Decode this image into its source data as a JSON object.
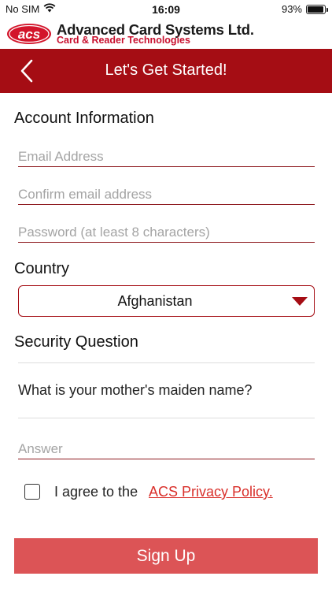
{
  "status_bar": {
    "carrier": "No SIM",
    "time": "16:09",
    "battery": "93%",
    "battery_level": 0.93,
    "wifi_icon": "wifi-icon",
    "battery_icon": "battery-icon"
  },
  "brand": {
    "logo_text": "acs",
    "name": "Advanced Card Systems Ltd.",
    "tagline": "Card & Reader Technologies",
    "accent": "#c8102e"
  },
  "header": {
    "back_icon": "chevron-left-icon",
    "title": "Let's Get Started!",
    "background": "#a50d14"
  },
  "account": {
    "heading": "Account Information",
    "email_placeholder": "Email Address",
    "confirm_email_placeholder": "Confirm email address",
    "password_placeholder": "Password (at least 8 characters)"
  },
  "country": {
    "heading": "Country",
    "selected": "Afghanistan",
    "arrow_icon": "triangle-down-icon"
  },
  "security": {
    "heading": "Security Question",
    "question": "What is your mother's maiden name?",
    "answer_placeholder": "Answer"
  },
  "agreement": {
    "text": "I agree to the",
    "link": "ACS Privacy Policy.",
    "link_color": "#d9302b"
  },
  "signup": {
    "label": "Sign Up",
    "color": "#dc5456"
  }
}
